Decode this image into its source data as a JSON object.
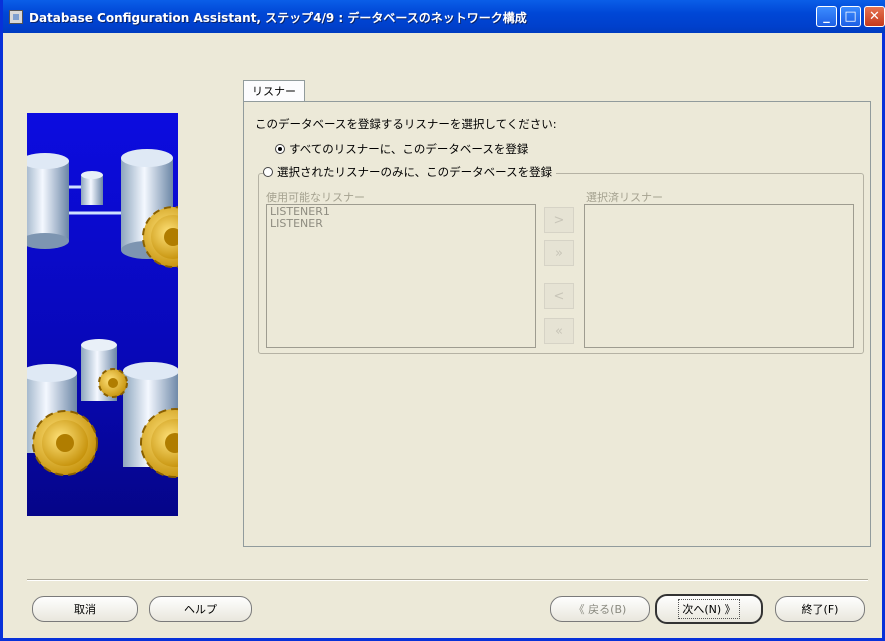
{
  "window": {
    "title": "Database Configuration Assistant, ステップ4/9 : データベースのネットワーク構成"
  },
  "titlebar_buttons": {
    "minimize": "_",
    "maximize": "□",
    "close": "✕"
  },
  "tab": {
    "label": "リスナー"
  },
  "instruction": "このデータベースを登録するリスナーを選択してください:",
  "options": {
    "all": {
      "label": "すべてのリスナーに、このデータベースを登録",
      "selected": true
    },
    "selected": {
      "label": "選択されたリスナーのみに、このデータベースを登録",
      "selected": false
    }
  },
  "available": {
    "label": "使用可能なリスナー",
    "items": [
      "LISTENER1",
      "LISTENER"
    ]
  },
  "chosen": {
    "label": "選択済リスナー",
    "items": []
  },
  "move_buttons": {
    "add": ">",
    "add_all": "»",
    "remove": "<",
    "remove_all": "«"
  },
  "footer": {
    "cancel": "取消",
    "help": "ヘルプ",
    "back": "《 戻る(B)",
    "next": "次へ(N) 》",
    "finish": "終了(F)"
  },
  "colors": {
    "title_bar": "#0047d6",
    "art_background": "#0808b8",
    "window_bg": "#ece9d8"
  }
}
